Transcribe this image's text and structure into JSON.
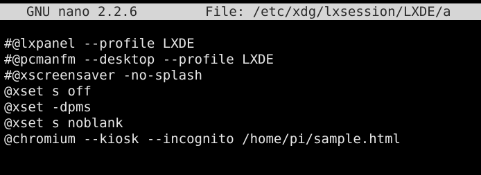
{
  "titlebar": {
    "app_version": "GNU nano 2.2.6",
    "file_label": "File: /etc/xdg/lxsession/LXDE/a"
  },
  "editor": {
    "lines": [
      "#@lxpanel --profile LXDE",
      "#@pcmanfm --desktop --profile LXDE",
      "#@xscreensaver -no-splash",
      "@xset s off",
      "@xset -dpms",
      "@xset s noblank",
      "@chromium --kiosk --incognito /home/pi/sample.html"
    ]
  },
  "colors": {
    "background": "#000000",
    "titlebar_bg": "#d6d6d6",
    "titlebar_text": "#2a2a2a",
    "text": "#e6e6e6"
  }
}
